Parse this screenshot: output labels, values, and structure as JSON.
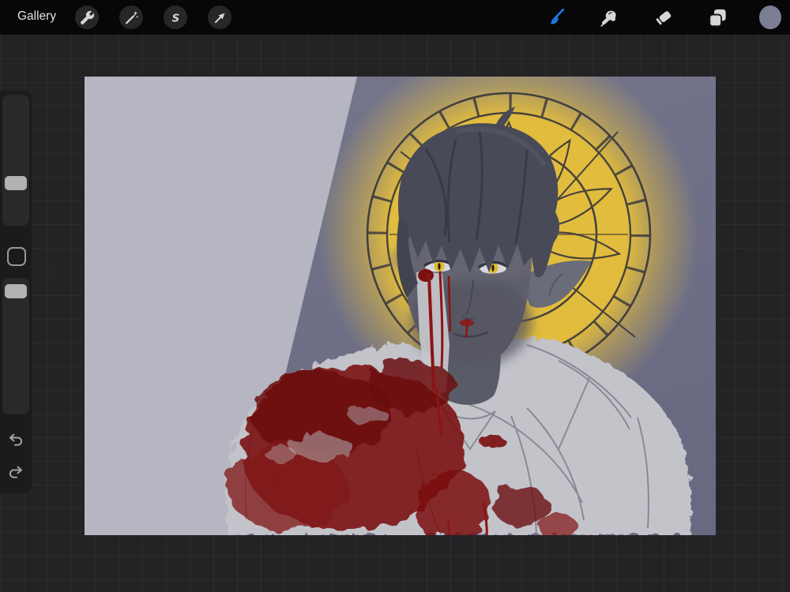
{
  "topbar": {
    "gallery_label": "Gallery",
    "selection_glyph": "S",
    "accent_blue": "#1d74e4",
    "left_tools": [
      "actions-wrench",
      "adjustments-wand",
      "selection-s",
      "transform-arrow"
    ],
    "right_tools": [
      "paint-brush (active)",
      "smudge",
      "erase",
      "layers",
      "color-swatch"
    ],
    "current_color": "#7b7d93"
  },
  "sidebar": {
    "controls": [
      "brush-size-slider",
      "modify-button",
      "opacity-slider",
      "undo-button",
      "redo-button"
    ]
  },
  "canvas": {
    "workspace_background": "#232326",
    "artwork_palette": {
      "background_left_wedge": "#b6b6c2",
      "background_right": "#6e6f88",
      "halo_yellow": "#e2bc3d",
      "ornament_line": "#33333b",
      "hair": "#484a57",
      "skin": "#60616d",
      "eye_iris": "#dfba2e",
      "blood": "#7a1212",
      "body_sketch": "#c3c3ca"
    }
  }
}
